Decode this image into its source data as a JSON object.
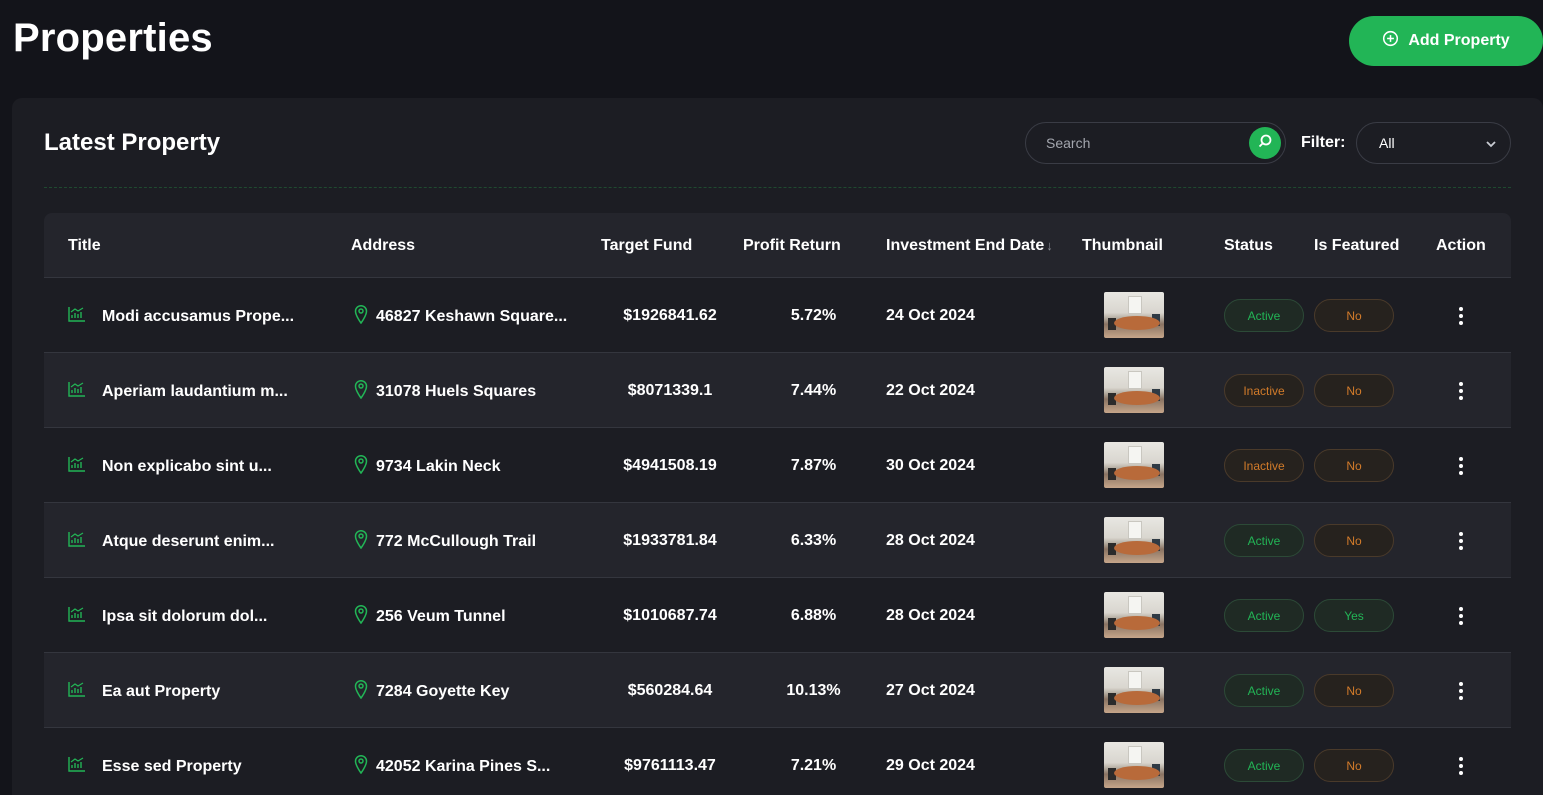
{
  "page": {
    "title": "Properties"
  },
  "add_button": {
    "label": "Add Property",
    "icon": "plus-circle-icon"
  },
  "panel": {
    "title": "Latest Property"
  },
  "search": {
    "placeholder": "Search",
    "value": "",
    "icon": "search-icon"
  },
  "filter": {
    "label": "Filter:",
    "selected": "All"
  },
  "columns": {
    "title": "Title",
    "address": "Address",
    "target_fund": "Target Fund",
    "profit_return": "Profit Return",
    "end_date": "Investment End Date",
    "end_date_sort": "↓",
    "thumbnail": "Thumbnail",
    "status": "Status",
    "featured": "Is Featured",
    "action": "Action"
  },
  "rows": [
    {
      "title": "Modi accusamus Prope...",
      "address": "46827 Keshawn Square...",
      "fund": "$1926841.62",
      "profit": "5.72%",
      "date": "24 Oct 2024",
      "status": "Active",
      "featured": "No"
    },
    {
      "title": "Aperiam laudantium m...",
      "address": "31078 Huels Squares",
      "fund": "$8071339.1",
      "profit": "7.44%",
      "date": "22 Oct 2024",
      "status": "Inactive",
      "featured": "No"
    },
    {
      "title": "Non explicabo sint u...",
      "address": "9734 Lakin Neck",
      "fund": "$4941508.19",
      "profit": "7.87%",
      "date": "30 Oct 2024",
      "status": "Inactive",
      "featured": "No"
    },
    {
      "title": "Atque deserunt enim...",
      "address": "772 McCullough Trail",
      "fund": "$1933781.84",
      "profit": "6.33%",
      "date": "28 Oct 2024",
      "status": "Active",
      "featured": "No"
    },
    {
      "title": "Ipsa sit dolorum dol...",
      "address": "256 Veum Tunnel",
      "fund": "$1010687.74",
      "profit": "6.88%",
      "date": "28 Oct 2024",
      "status": "Active",
      "featured": "Yes"
    },
    {
      "title": "Ea aut Property",
      "address": "7284 Goyette Key",
      "fund": "$560284.64",
      "profit": "10.13%",
      "date": "27 Oct 2024",
      "status": "Active",
      "featured": "No"
    },
    {
      "title": "Esse sed Property",
      "address": "42052 Karina Pines S...",
      "fund": "$9761113.47",
      "profit": "7.21%",
      "date": "29 Oct 2024",
      "status": "Active",
      "featured": "No"
    }
  ],
  "colors": {
    "accent": "#22b556",
    "warning": "#d27b2a",
    "background": "#13141a",
    "panel": "#1c1d23"
  }
}
